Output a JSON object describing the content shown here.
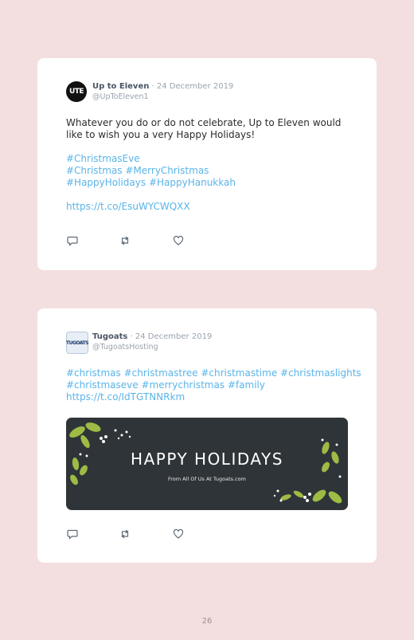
{
  "page_number": "26",
  "colors": {
    "background": "#f4dfe0",
    "link": "#5ab4e8",
    "banner": "#2f3438",
    "leaf": "#9dbb45"
  },
  "tweets": [
    {
      "avatar_text": "UTE",
      "name": "Up to Eleven",
      "date": "· 24 December 2019",
      "handle": "@UpToEleven1",
      "lines": [
        "Whatever you do or do not celebrate, Up to Eleven would",
        "like to wish you a very Happy Holidays!"
      ],
      "tags": [
        "#ChristmasEve",
        "#Christmas #MerryChristmas",
        "#HappyHolidays #HappyHanukkah"
      ],
      "link": "https://t.co/EsuWYCWQXX",
      "icons": [
        "reply-icon",
        "retweet-icon",
        "like-icon"
      ]
    },
    {
      "avatar_text": "TUGOATS",
      "name": "Tugoats",
      "date": "· 24 December 2019",
      "handle": "@TugoatsHosting",
      "tags": [
        "#christmas #christmastree #christmastime #christmaslights",
        "#christmaseve #merrychristmas #family"
      ],
      "link": "https://t.co/IdTGTNNRkm",
      "image": {
        "title": "HAPPY HOLIDAYS",
        "subtitle": "From All Of Us At Tugoats.com"
      },
      "icons": [
        "reply-icon",
        "retweet-icon",
        "like-icon"
      ]
    }
  ]
}
